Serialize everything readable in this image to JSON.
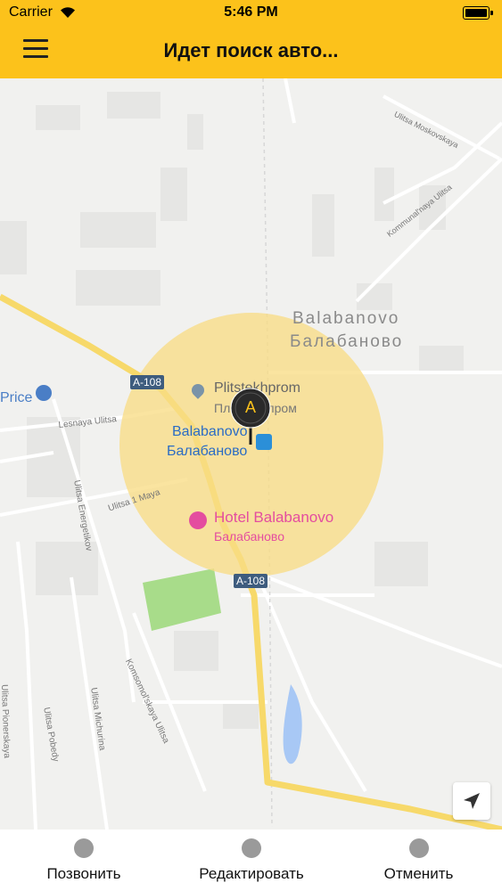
{
  "status_bar": {
    "carrier": "Carrier",
    "time": "5:46 PM"
  },
  "header": {
    "title": "Идет поиск авто...",
    "menu_icon": "hamburger-menu-icon"
  },
  "map": {
    "labels": {
      "street_moskovskaya": "Ulitsa Moskovskaya",
      "street_kommunalnaya": "Kommunal'naya Ulitsa",
      "town_latin": "Balabanovo",
      "town_cyrillic": "Балабаново",
      "price": "Price",
      "road_a108_top": "A-108",
      "road_a108_bottom": "A-108",
      "poi_latin": "Plitstekhprom",
      "poi_cyrillic": "Плитстехпром",
      "lesnaya": "Lesnaya Ulitsa",
      "station_latin": "Balabanovo",
      "station_cyrillic": "Балабаново",
      "maya": "Ulitsa 1 Maya",
      "hotel_latin": "Hotel Balabanovo",
      "hotel_cyrillic": "Балабаново",
      "energetikov": "Ulitsa Energetikov",
      "komsomolskaya": "Komsomol'skaya Ulitsa",
      "pionerskaya": "Ulitsa Pionerskaya",
      "pobedy": "Ulitsa Pobedy",
      "michurina": "Ulitsa Michurina"
    },
    "marker_letter": "A",
    "colors": {
      "accent": "#fcc21b",
      "radius_fill": "#f8dd85",
      "road": "#f7d96a",
      "park": "#a8dc8a",
      "water": "#a8c8f5",
      "poi_blue": "#4a7ec6",
      "poi_pink": "#e44d9f"
    }
  },
  "actions": [
    {
      "label": "Позвонить",
      "icon": "phone-icon"
    },
    {
      "label": "Редактировать",
      "icon": "pencil-icon"
    },
    {
      "label": "Отменить",
      "icon": "close-icon"
    }
  ],
  "locate_icon": "navigation-arrow-icon"
}
